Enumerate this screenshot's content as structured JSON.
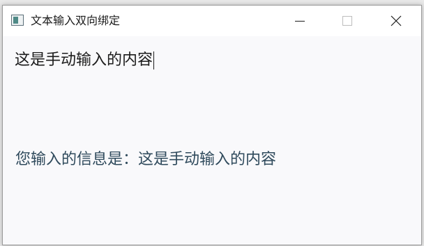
{
  "window": {
    "title": "文本输入双向绑定",
    "icon": "app-window-icon"
  },
  "controls": {
    "minimize_icon": "minimize-icon",
    "maximize_icon": "maximize-icon",
    "close_icon": "close-icon"
  },
  "input": {
    "value": "这是手动输入的内容"
  },
  "output": {
    "label": "您输入的信息是：",
    "value": "这是手动输入的内容"
  },
  "colors": {
    "titlebar_bg": "#ffffff",
    "content_bg": "#f9f9fb",
    "output_text": "#2f4a5c",
    "icon_accent": "#4f8a87"
  }
}
